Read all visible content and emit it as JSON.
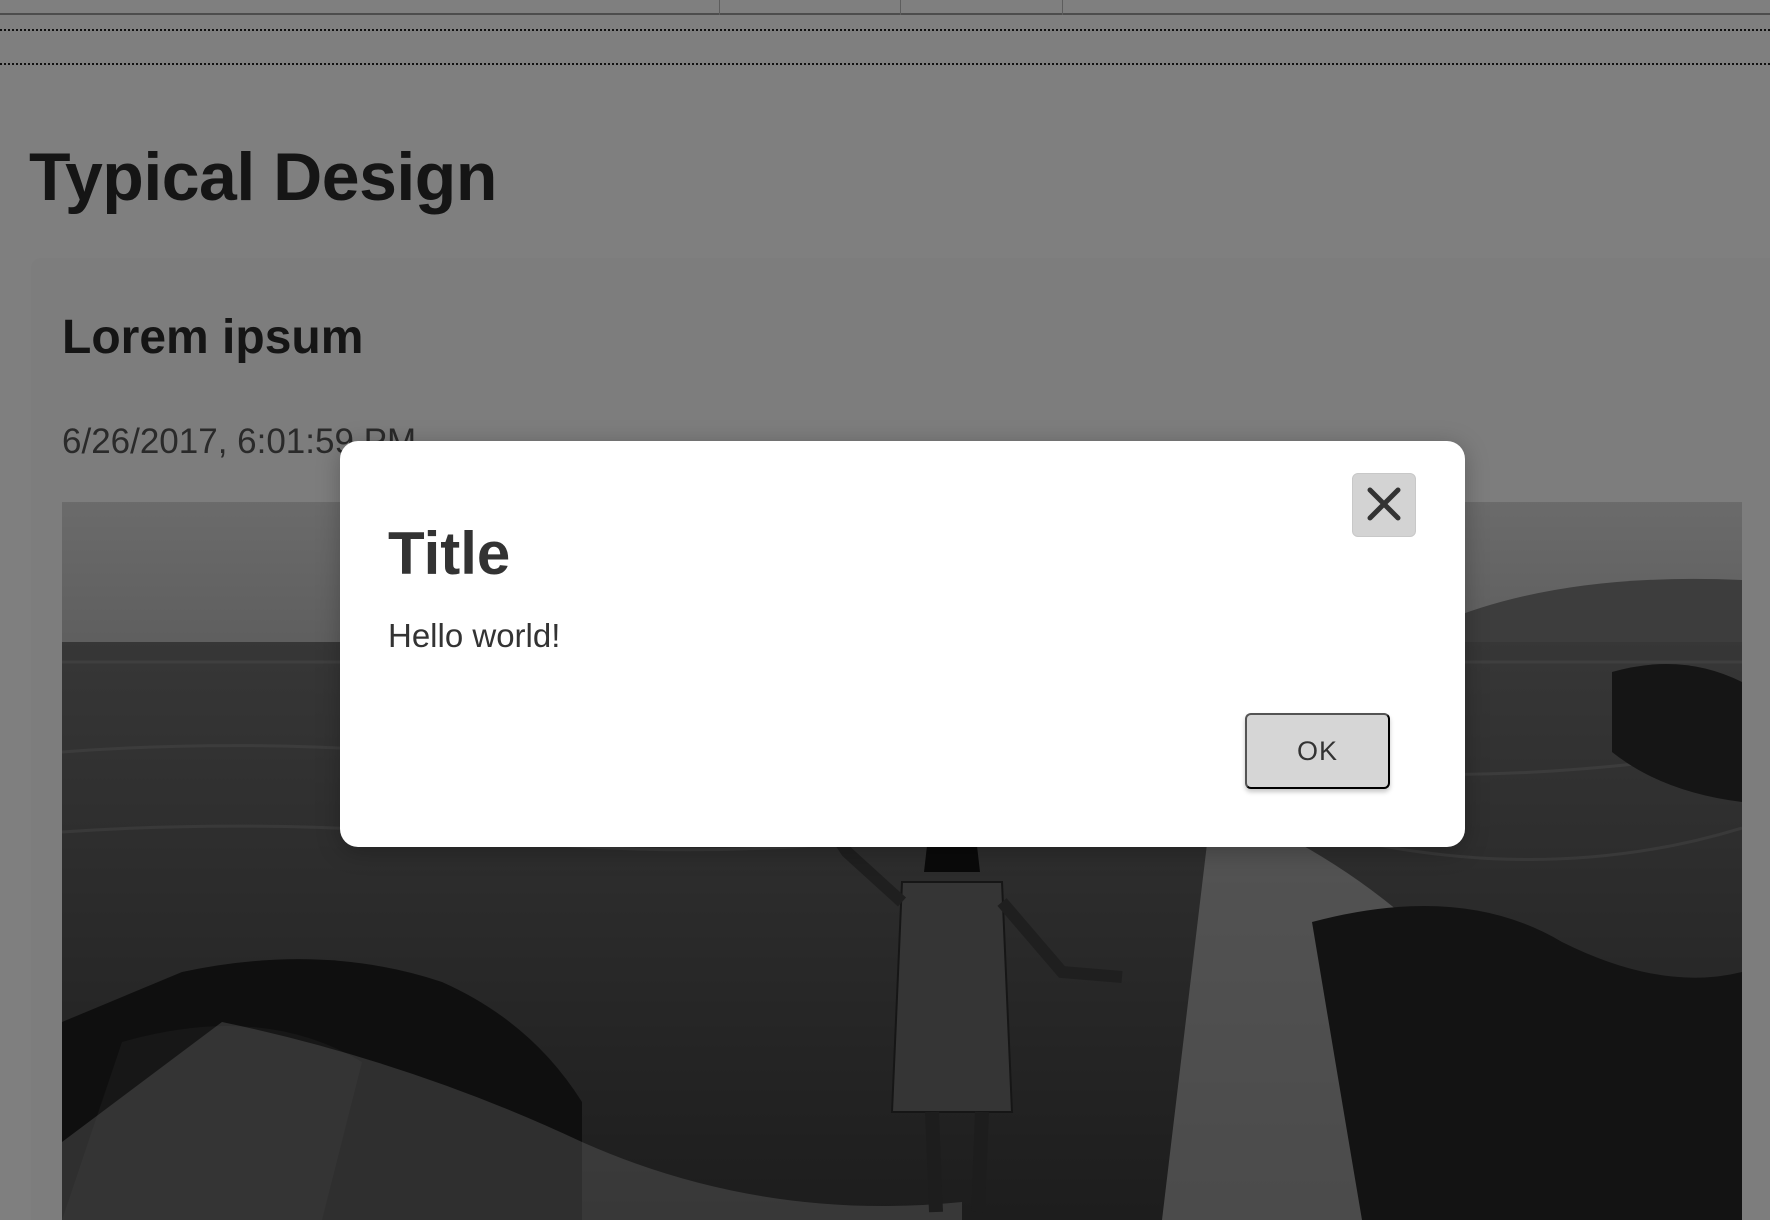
{
  "page": {
    "title": "Typical Design"
  },
  "card": {
    "title": "Lorem ipsum",
    "date": "6/26/2017, 6:01:59 PM",
    "image_alt": "woman on rocky shore with crashing waves"
  },
  "dialog": {
    "title": "Title",
    "message": "Hello world!",
    "ok_label": "OK",
    "close_icon": "close-icon"
  },
  "colors": {
    "overlay": "#000000",
    "dialog_bg": "#ffffff",
    "button_bg": "#d6d6d6",
    "text": "#333333"
  }
}
